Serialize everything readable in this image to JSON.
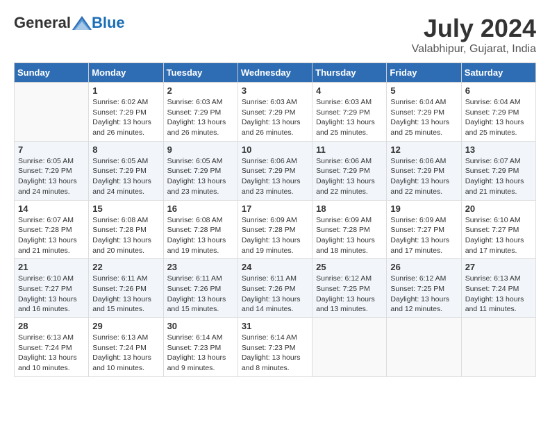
{
  "header": {
    "logo_general": "General",
    "logo_blue": "Blue",
    "month_year": "July 2024",
    "location": "Valabhipur, Gujarat, India"
  },
  "days_of_week": [
    "Sunday",
    "Monday",
    "Tuesday",
    "Wednesday",
    "Thursday",
    "Friday",
    "Saturday"
  ],
  "weeks": [
    [
      {
        "day": "",
        "sunrise": "",
        "sunset": "",
        "daylight": ""
      },
      {
        "day": "1",
        "sunrise": "Sunrise: 6:02 AM",
        "sunset": "Sunset: 7:29 PM",
        "daylight": "Daylight: 13 hours and 26 minutes."
      },
      {
        "day": "2",
        "sunrise": "Sunrise: 6:03 AM",
        "sunset": "Sunset: 7:29 PM",
        "daylight": "Daylight: 13 hours and 26 minutes."
      },
      {
        "day": "3",
        "sunrise": "Sunrise: 6:03 AM",
        "sunset": "Sunset: 7:29 PM",
        "daylight": "Daylight: 13 hours and 26 minutes."
      },
      {
        "day": "4",
        "sunrise": "Sunrise: 6:03 AM",
        "sunset": "Sunset: 7:29 PM",
        "daylight": "Daylight: 13 hours and 25 minutes."
      },
      {
        "day": "5",
        "sunrise": "Sunrise: 6:04 AM",
        "sunset": "Sunset: 7:29 PM",
        "daylight": "Daylight: 13 hours and 25 minutes."
      },
      {
        "day": "6",
        "sunrise": "Sunrise: 6:04 AM",
        "sunset": "Sunset: 7:29 PM",
        "daylight": "Daylight: 13 hours and 25 minutes."
      }
    ],
    [
      {
        "day": "7",
        "sunrise": "Sunrise: 6:05 AM",
        "sunset": "Sunset: 7:29 PM",
        "daylight": "Daylight: 13 hours and 24 minutes."
      },
      {
        "day": "8",
        "sunrise": "Sunrise: 6:05 AM",
        "sunset": "Sunset: 7:29 PM",
        "daylight": "Daylight: 13 hours and 24 minutes."
      },
      {
        "day": "9",
        "sunrise": "Sunrise: 6:05 AM",
        "sunset": "Sunset: 7:29 PM",
        "daylight": "Daylight: 13 hours and 23 minutes."
      },
      {
        "day": "10",
        "sunrise": "Sunrise: 6:06 AM",
        "sunset": "Sunset: 7:29 PM",
        "daylight": "Daylight: 13 hours and 23 minutes."
      },
      {
        "day": "11",
        "sunrise": "Sunrise: 6:06 AM",
        "sunset": "Sunset: 7:29 PM",
        "daylight": "Daylight: 13 hours and 22 minutes."
      },
      {
        "day": "12",
        "sunrise": "Sunrise: 6:06 AM",
        "sunset": "Sunset: 7:29 PM",
        "daylight": "Daylight: 13 hours and 22 minutes."
      },
      {
        "day": "13",
        "sunrise": "Sunrise: 6:07 AM",
        "sunset": "Sunset: 7:29 PM",
        "daylight": "Daylight: 13 hours and 21 minutes."
      }
    ],
    [
      {
        "day": "14",
        "sunrise": "Sunrise: 6:07 AM",
        "sunset": "Sunset: 7:28 PM",
        "daylight": "Daylight: 13 hours and 21 minutes."
      },
      {
        "day": "15",
        "sunrise": "Sunrise: 6:08 AM",
        "sunset": "Sunset: 7:28 PM",
        "daylight": "Daylight: 13 hours and 20 minutes."
      },
      {
        "day": "16",
        "sunrise": "Sunrise: 6:08 AM",
        "sunset": "Sunset: 7:28 PM",
        "daylight": "Daylight: 13 hours and 19 minutes."
      },
      {
        "day": "17",
        "sunrise": "Sunrise: 6:09 AM",
        "sunset": "Sunset: 7:28 PM",
        "daylight": "Daylight: 13 hours and 19 minutes."
      },
      {
        "day": "18",
        "sunrise": "Sunrise: 6:09 AM",
        "sunset": "Sunset: 7:28 PM",
        "daylight": "Daylight: 13 hours and 18 minutes."
      },
      {
        "day": "19",
        "sunrise": "Sunrise: 6:09 AM",
        "sunset": "Sunset: 7:27 PM",
        "daylight": "Daylight: 13 hours and 17 minutes."
      },
      {
        "day": "20",
        "sunrise": "Sunrise: 6:10 AM",
        "sunset": "Sunset: 7:27 PM",
        "daylight": "Daylight: 13 hours and 17 minutes."
      }
    ],
    [
      {
        "day": "21",
        "sunrise": "Sunrise: 6:10 AM",
        "sunset": "Sunset: 7:27 PM",
        "daylight": "Daylight: 13 hours and 16 minutes."
      },
      {
        "day": "22",
        "sunrise": "Sunrise: 6:11 AM",
        "sunset": "Sunset: 7:26 PM",
        "daylight": "Daylight: 13 hours and 15 minutes."
      },
      {
        "day": "23",
        "sunrise": "Sunrise: 6:11 AM",
        "sunset": "Sunset: 7:26 PM",
        "daylight": "Daylight: 13 hours and 15 minutes."
      },
      {
        "day": "24",
        "sunrise": "Sunrise: 6:11 AM",
        "sunset": "Sunset: 7:26 PM",
        "daylight": "Daylight: 13 hours and 14 minutes."
      },
      {
        "day": "25",
        "sunrise": "Sunrise: 6:12 AM",
        "sunset": "Sunset: 7:25 PM",
        "daylight": "Daylight: 13 hours and 13 minutes."
      },
      {
        "day": "26",
        "sunrise": "Sunrise: 6:12 AM",
        "sunset": "Sunset: 7:25 PM",
        "daylight": "Daylight: 13 hours and 12 minutes."
      },
      {
        "day": "27",
        "sunrise": "Sunrise: 6:13 AM",
        "sunset": "Sunset: 7:24 PM",
        "daylight": "Daylight: 13 hours and 11 minutes."
      }
    ],
    [
      {
        "day": "28",
        "sunrise": "Sunrise: 6:13 AM",
        "sunset": "Sunset: 7:24 PM",
        "daylight": "Daylight: 13 hours and 10 minutes."
      },
      {
        "day": "29",
        "sunrise": "Sunrise: 6:13 AM",
        "sunset": "Sunset: 7:24 PM",
        "daylight": "Daylight: 13 hours and 10 minutes."
      },
      {
        "day": "30",
        "sunrise": "Sunrise: 6:14 AM",
        "sunset": "Sunset: 7:23 PM",
        "daylight": "Daylight: 13 hours and 9 minutes."
      },
      {
        "day": "31",
        "sunrise": "Sunrise: 6:14 AM",
        "sunset": "Sunset: 7:23 PM",
        "daylight": "Daylight: 13 hours and 8 minutes."
      },
      {
        "day": "",
        "sunrise": "",
        "sunset": "",
        "daylight": ""
      },
      {
        "day": "",
        "sunrise": "",
        "sunset": "",
        "daylight": ""
      },
      {
        "day": "",
        "sunrise": "",
        "sunset": "",
        "daylight": ""
      }
    ]
  ]
}
